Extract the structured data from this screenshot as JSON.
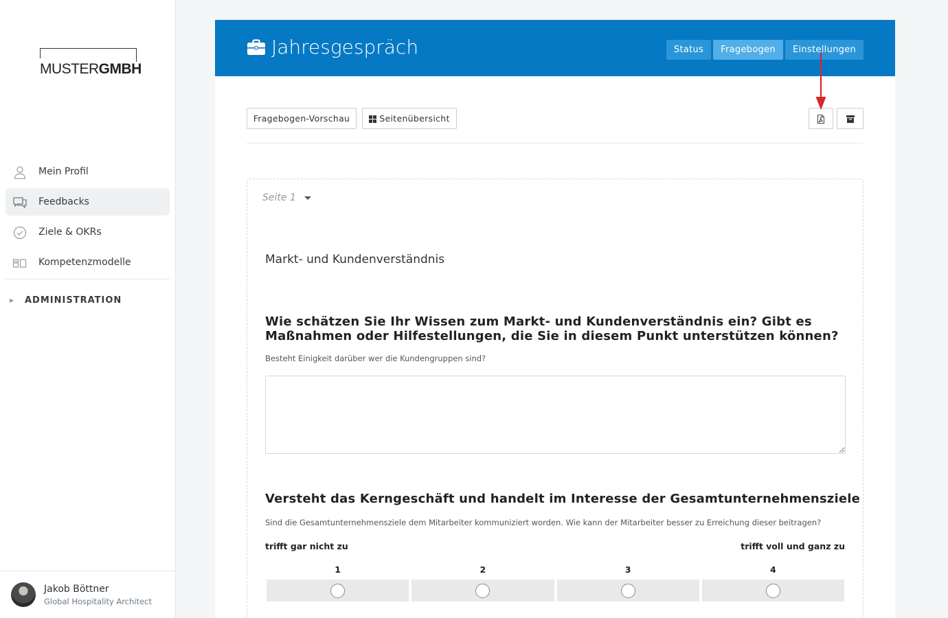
{
  "logo": {
    "part1": "MUSTER",
    "part2": "GMBH"
  },
  "nav": {
    "items": [
      {
        "label": "Mein Profil",
        "icon": "user-icon"
      },
      {
        "label": "Feedbacks",
        "icon": "chat-icon",
        "active": true
      },
      {
        "label": "Ziele & OKRs",
        "icon": "check-circle-icon"
      },
      {
        "label": "Kompetenzmodelle",
        "icon": "layout-icon"
      }
    ],
    "admin_label": "ADMINISTRATION"
  },
  "user": {
    "name": "Jakob Böttner",
    "role": "Global Hospitality Architect"
  },
  "header": {
    "title": "Jahresgespräch",
    "title_icon": "briefcase-icon",
    "tabs": [
      {
        "label": "Status"
      },
      {
        "label": "Fragebogen",
        "active": true
      },
      {
        "label": "Einstellungen"
      }
    ],
    "color": "#0679c4"
  },
  "toolbar": {
    "preview_label": "Fragebogen-Vorschau",
    "overview_label": "Seitenübersicht",
    "pdf_icon": "pdf-icon",
    "archive_icon": "archive-icon"
  },
  "annotation": {
    "arrow_color": "#d9262a"
  },
  "page": {
    "selector": "Seite 1",
    "section_title": "Markt- und Kundenverständnis",
    "question1": {
      "text": "Wie schätzen Sie Ihr Wissen zum Markt- und Kundenverständnis ein? Gibt es Maßnahmen oder Hilfestellungen, die Sie in diesem Punkt unterstützen können?",
      "hint": "Besteht Einigkeit darüber wer die Kundengruppen sind?",
      "answer": ""
    },
    "question2": {
      "text": "Versteht das Kerngeschäft und handelt im Interesse der Gesamtunternehmensziele",
      "hint": "Sind die Gesamtunternehmensziele dem Mitarbeiter kommuniziert worden. Wie kann der Mitarbeiter besser zu Erreichung dieser beitragen?",
      "scale_low": "trifft gar nicht zu",
      "scale_high": "trifft voll und ganz zu",
      "options": [
        "1",
        "2",
        "3",
        "4"
      ]
    }
  }
}
